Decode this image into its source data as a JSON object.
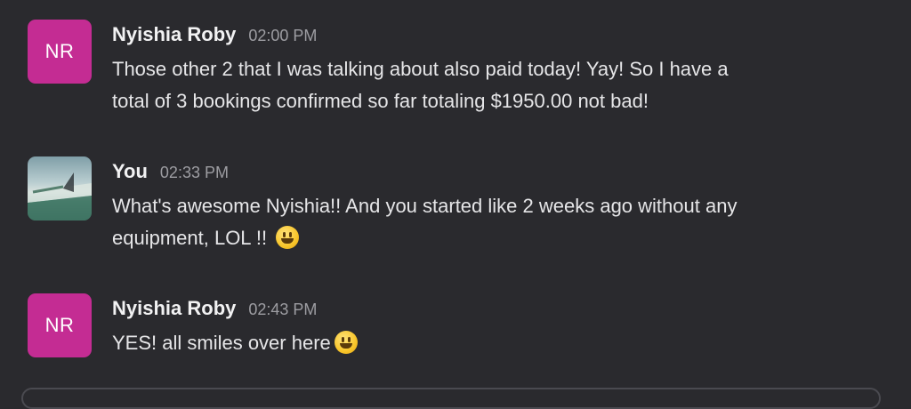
{
  "messages": [
    {
      "avatar_initials": "NR",
      "author": "Nyishia Roby",
      "time": "02:00 PM",
      "lines": [
        "Those other 2 that I was talking about also paid today! Yay! So I have a",
        "total of 3 bookings confirmed so far totaling $1950.00 not bad!"
      ]
    },
    {
      "avatar_initials": "",
      "author": "You",
      "time": "02:33 PM",
      "lines": [
        "What's awesome Nyishia!! And you started like 2 weeks ago without any",
        "equipment, LOL !! "
      ]
    },
    {
      "avatar_initials": "NR",
      "author": "Nyishia Roby",
      "time": "02:43 PM",
      "lines": [
        "YES! all smiles over here"
      ]
    }
  ],
  "icons": {
    "emoji_1": "grinning-face-emoji-icon",
    "emoji_2": "smiling-face-emoji-icon"
  },
  "colors": {
    "background": "#2a2a2e",
    "avatar_accent": "#c42c93",
    "text_primary": "#e6e6e8",
    "text_secondary": "#9d9da2"
  }
}
